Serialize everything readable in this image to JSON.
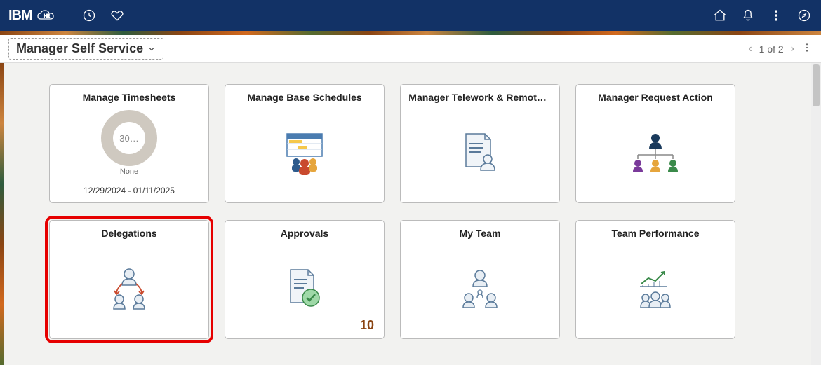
{
  "header": {
    "brand": "IBM",
    "sub_brand": "HR"
  },
  "subheader": {
    "dropdown_label": "Manager Self Service",
    "pager_text": "1 of 2"
  },
  "tiles": [
    {
      "title": "Manage Timesheets",
      "donut_value": "30…",
      "donut_label": "None",
      "footer": "12/29/2024 - 01/11/2025"
    },
    {
      "title": "Manage Base Schedules"
    },
    {
      "title": "Manager Telework & Remote W…"
    },
    {
      "title": "Manager Request Action"
    },
    {
      "title": "Delegations"
    },
    {
      "title": "Approvals",
      "count": "10"
    },
    {
      "title": "My Team"
    },
    {
      "title": "Team Performance"
    }
  ]
}
